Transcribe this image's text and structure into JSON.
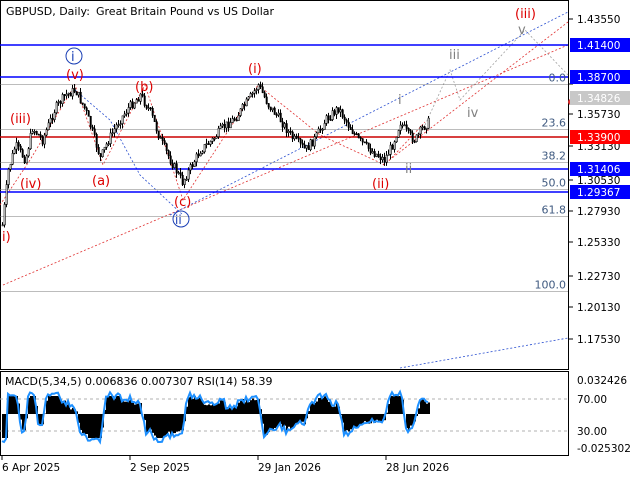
{
  "header": {
    "symbol": "GBPUSD, Daily:",
    "description": "Great Britain Pound vs US Dollar"
  },
  "indicator": {
    "label": "MACD(5,34,5) 0.006836 0.007307 RSI(14) 58.39"
  },
  "colors": {
    "axis_label": "#000000",
    "level_blue": "#0000ff",
    "level_red": "#ff0000",
    "level_label_fill_blue": "#0000ff",
    "level_label_fill_red": "#ff0000",
    "fib_text": "#3f5a80",
    "wave_red": "#dd0000",
    "wave_blue": "#1a3fb5",
    "wave_gray": "#808080",
    "histogram": "#000000",
    "rsi_line": "#1e90ff"
  },
  "chart_data": [
    {
      "type": "line",
      "title": "GBPUSD, Daily",
      "y_ticks": [
        "1.43550",
        "1.38700",
        "1.35730",
        "1.33130",
        "1.30530",
        "1.27930",
        "1.25330",
        "1.22730",
        "1.20130",
        "1.17530"
      ],
      "x_ticks": [
        "6 Apr 2025",
        "2 Sep 2025",
        "29 Jan 2026",
        "28 Jun 2026"
      ],
      "levels": [
        {
          "value": "1.41400",
          "color": "blue"
        },
        {
          "value": "1.38700",
          "color": "blue"
        },
        {
          "value": "1.33900",
          "color": "red"
        },
        {
          "value": "1.31406",
          "color": "blue"
        },
        {
          "value": "1.29367",
          "color": "blue"
        }
      ],
      "current_price": "1.34826",
      "fibonacci": [
        {
          "label": "0.0",
          "value": 1.387
        },
        {
          "label": "23.6",
          "value": 1.348
        },
        {
          "label": "38.2",
          "value": 1.319
        },
        {
          "label": "50.0",
          "value": 1.296
        },
        {
          "label": "61.8",
          "value": 1.273
        },
        {
          "label": "100.0",
          "value": 1.2075
        }
      ],
      "wave_labels": [
        {
          "text": "(iii)",
          "color": "red"
        },
        {
          "text": "v",
          "color": "gray"
        },
        {
          "text": "i",
          "color": "blue",
          "circled": true
        },
        {
          "text": "(v)",
          "color": "red"
        },
        {
          "text": "(b)",
          "color": "red"
        },
        {
          "text": "(i)",
          "color": "red"
        },
        {
          "text": "iii",
          "color": "gray"
        },
        {
          "text": "i",
          "color": "gray"
        },
        {
          "text": "iv",
          "color": "gray"
        },
        {
          "text": "(iii)",
          "color": "red"
        },
        {
          "text": "(a)",
          "color": "red"
        },
        {
          "text": "(iv)",
          "color": "red"
        },
        {
          "text": "(ii)",
          "color": "red"
        },
        {
          "text": "ii",
          "color": "gray"
        },
        {
          "text": "(c)",
          "color": "red"
        },
        {
          "text": "ii",
          "color": "blue",
          "circled": true
        },
        {
          "text": "i)",
          "color": "red"
        }
      ]
    },
    {
      "type": "bar",
      "title": "MACD(5,34,5) / RSI(14)",
      "values": [
        0.006836,
        0.007307
      ],
      "rsi": 58.39,
      "y_ticks": [
        "0.032426",
        "70.00",
        "30.00",
        "-0.025302"
      ]
    }
  ]
}
